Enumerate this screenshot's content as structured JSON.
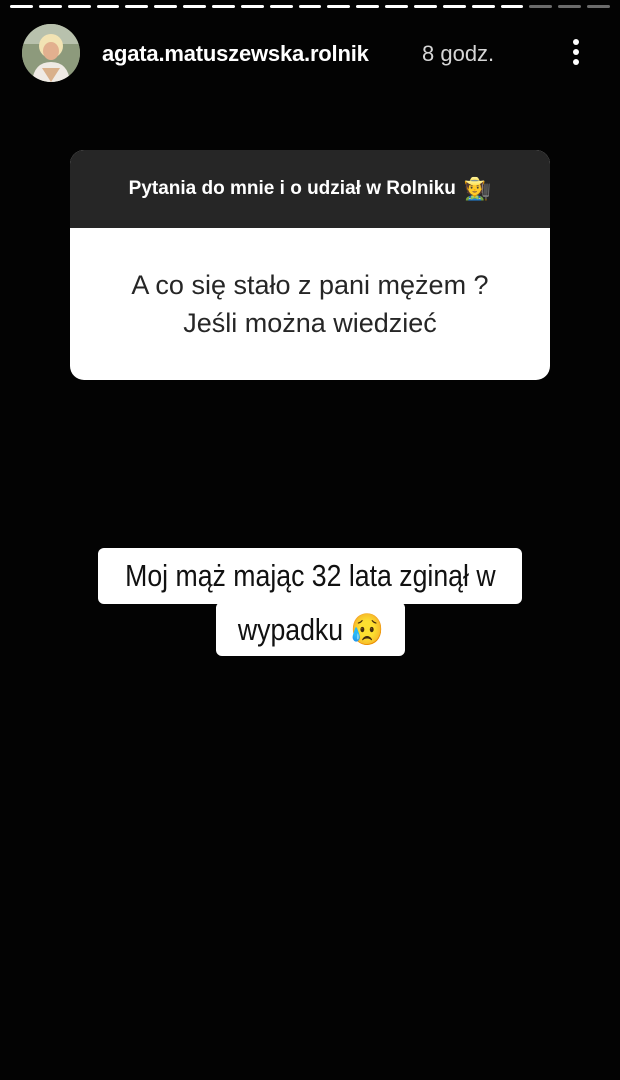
{
  "story": {
    "progress_segments_total": 21,
    "progress_segments_viewed": 18,
    "username": "agata.matuszewska.rolnik",
    "timestamp": "8 godz.",
    "more_icon": "more-vertical-icon"
  },
  "question_sticker": {
    "header": "Pytania do mnie i o udział w Rolniku",
    "header_emoji": "🧑‍🌾",
    "question_line1": "A co się stało z pani mężem ?",
    "question_line2": "Jeśli można wiedzieć"
  },
  "answer": {
    "line1": "Moj mąż mając 32 lata zginął w",
    "line2": "wypadku 😥"
  },
  "colors": {
    "background": "#030303",
    "sticker_header_bg": "#262626",
    "sticker_body_bg": "#ffffff",
    "progress_viewed": "#ffffff",
    "progress_unviewed": "#6b6b6b"
  }
}
